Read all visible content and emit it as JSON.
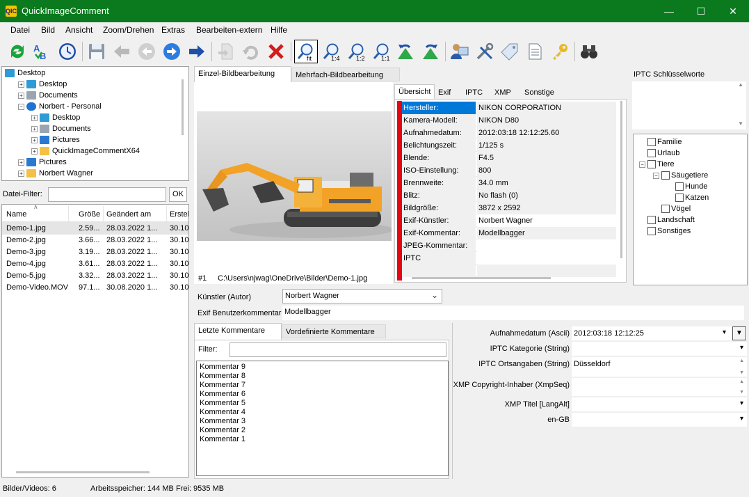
{
  "window": {
    "title": "QuickImageComment",
    "app_icon_text": "QIC"
  },
  "menu": [
    "Datei",
    "Bild",
    "Ansicht",
    "Zoom/Drehen",
    "Extras",
    "Bearbeiten-extern",
    "Hilfe"
  ],
  "toolbar": {
    "zoom_fit": "fit",
    "zoom_1_4": "1:4",
    "zoom_1_2": "1:2",
    "zoom_1_1": "1:1"
  },
  "folder_tree": [
    {
      "label": "Desktop",
      "level": 0,
      "exp": "",
      "icon": "desktop"
    },
    {
      "label": "Desktop",
      "level": 1,
      "exp": "+",
      "icon": "desktop"
    },
    {
      "label": "Documents",
      "level": 1,
      "exp": "+",
      "icon": "docs"
    },
    {
      "label": "Norbert - Personal",
      "level": 1,
      "exp": "-",
      "icon": "cloud"
    },
    {
      "label": "Desktop",
      "level": 2,
      "exp": "+",
      "icon": "desktop"
    },
    {
      "label": "Documents",
      "level": 2,
      "exp": "+",
      "icon": "docs"
    },
    {
      "label": "Pictures",
      "level": 2,
      "exp": "+",
      "icon": "pics"
    },
    {
      "label": "QuickImageCommentX64",
      "level": 2,
      "exp": "+",
      "icon": "folder"
    },
    {
      "label": "Pictures",
      "level": 1,
      "exp": "+",
      "icon": "pics"
    },
    {
      "label": "Norbert Wagner",
      "level": 1,
      "exp": "+",
      "icon": "folder"
    }
  ],
  "file_filter": {
    "label": "Datei-Filter:",
    "value": "",
    "ok": "OK"
  },
  "file_list": {
    "columns": [
      "Name",
      "Größe",
      "Geändert am",
      "Erstel"
    ],
    "rows": [
      [
        "Demo-1.jpg",
        "2.59...",
        "28.03.2022 1...",
        "30.10"
      ],
      [
        "Demo-2.jpg",
        "3.66...",
        "28.03.2022 1...",
        "30.10"
      ],
      [
        "Demo-3.jpg",
        "3.19...",
        "28.03.2022 1...",
        "30.10"
      ],
      [
        "Demo-4.jpg",
        "3.61...",
        "28.03.2022 1...",
        "30.10"
      ],
      [
        "Demo-5.jpg",
        "3.32...",
        "28.03.2022 1...",
        "30.10"
      ],
      [
        "Demo-Video.MOV",
        "97.1...",
        "30.08.2020 1...",
        "30.10"
      ]
    ]
  },
  "edit_tabs": [
    "Einzel-Bildbearbeitung",
    "Mehrfach-Bildbearbeitung"
  ],
  "image_caption": {
    "index": "#1",
    "path": "C:\\Users\\njwag\\OneDrive\\Bilder\\Demo-1.jpg"
  },
  "meta_tabs": [
    "Übersicht",
    "Exif",
    "IPTC",
    "XMP",
    "Sonstige"
  ],
  "meta_rows": [
    [
      "Hersteller:",
      "NIKON CORPORATION"
    ],
    [
      "Kamera-Modell:",
      "NIKON D80"
    ],
    [
      "Aufnahmedatum:",
      "2012:03:18 12:12:25.60"
    ],
    [
      "Belichtungszeit:",
      "1/125 s"
    ],
    [
      "Blende:",
      "F4.5"
    ],
    [
      "ISO-Einstellung:",
      "800"
    ],
    [
      "Brennweite:",
      "34.0 mm"
    ],
    [
      "Blitz:",
      "No flash (0)"
    ],
    [
      "Bildgröße:",
      "3872 x 2592"
    ],
    [
      "Exif-Künstler:",
      "Norbert Wagner"
    ],
    [
      "Exif-Kommentar:",
      "Modellbagger"
    ],
    [
      "JPEG-Kommentar:",
      ""
    ],
    [
      "IPTC Schlüsselworte:",
      ""
    ],
    [
      "",
      ""
    ]
  ],
  "artist": {
    "label": "Künstler (Autor)",
    "value": "Norbert Wagner"
  },
  "exif_comment": {
    "label": "Exif Benutzerkommentar",
    "value": "Modellbagger"
  },
  "comment_tabs": [
    "Letzte Kommentare",
    "Vordefinierte Kommentare"
  ],
  "comment_filter": {
    "label": "Filter:",
    "value": ""
  },
  "comments": [
    "Kommentar 9",
    "Kommentar 8",
    "Kommentar 7",
    "Kommentar 6",
    "Kommentar 5",
    "Kommentar 4",
    "Kommentar 3",
    "Kommentar 2",
    "Kommentar 1"
  ],
  "properties": [
    {
      "label": "Aufnahmedatum (Ascii)",
      "value": "2012:03:18 12:12:25"
    },
    {
      "label": "IPTC Kategorie (String)",
      "value": ""
    },
    {
      "label": "IPTC Ortsangaben (String)",
      "value": "Düsseldorf"
    },
    {
      "label": "XMP Copyright-Inhaber (XmpSeq)",
      "value": ""
    },
    {
      "label": "XMP Titel [LangAlt]",
      "value": ""
    },
    {
      "label": "en-GB",
      "value": ""
    }
  ],
  "iptc_keywords": {
    "header": "IPTC Schlüsselworte"
  },
  "keyword_tree": [
    {
      "label": "Familie",
      "level": 0,
      "exp": ""
    },
    {
      "label": "Urlaub",
      "level": 0,
      "exp": ""
    },
    {
      "label": "Tiere",
      "level": 0,
      "exp": "-"
    },
    {
      "label": "Säugetiere",
      "level": 1,
      "exp": "-"
    },
    {
      "label": "Hunde",
      "level": 2,
      "exp": ""
    },
    {
      "label": "Katzen",
      "level": 2,
      "exp": ""
    },
    {
      "label": "Vögel",
      "level": 1,
      "exp": ""
    },
    {
      "label": "Landschaft",
      "level": 0,
      "exp": ""
    },
    {
      "label": "Sonstiges",
      "level": 0,
      "exp": ""
    }
  ],
  "status": {
    "count": "Bilder/Videos: 6",
    "memory": "Arbeitsspeicher: 144 MB",
    "free": "Frei: 9535 MB"
  }
}
